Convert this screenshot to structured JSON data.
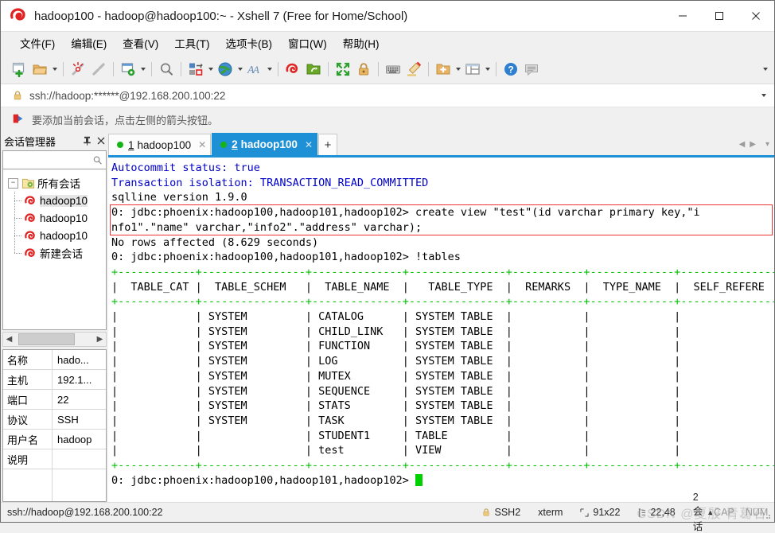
{
  "window": {
    "title": "hadoop100 - hadoop@hadoop100:~ - Xshell 7 (Free for Home/School)",
    "icon": "xshell-logo-icon",
    "minimize": "–",
    "maximize": "☐",
    "close": "✕"
  },
  "menu": {
    "items": [
      {
        "label": "文件(F)",
        "name": "menu-file"
      },
      {
        "label": "编辑(E)",
        "name": "menu-edit"
      },
      {
        "label": "查看(V)",
        "name": "menu-view"
      },
      {
        "label": "工具(T)",
        "name": "menu-tools"
      },
      {
        "label": "选项卡(B)",
        "name": "menu-tab"
      },
      {
        "label": "窗口(W)",
        "name": "menu-window"
      },
      {
        "label": "帮助(H)",
        "name": "menu-help"
      }
    ]
  },
  "toolbar": {
    "icons": [
      "new-session-icon",
      "open-folder-icon",
      "disconnect-icon",
      "reconnect-icon",
      "session-properties-icon",
      "find-icon",
      "transfer-file-icon",
      "globe-icon",
      "font-icon",
      "xshell-icon",
      "xftp-icon",
      "fullscreen-icon",
      "lock-icon",
      "keyboard-icon",
      "highlight-icon",
      "add-folder-icon",
      "layout-icon",
      "help-icon",
      "chat-icon"
    ],
    "overflow": "toolbar-overflow-caret"
  },
  "address": {
    "lock": "lock-icon",
    "value": "ssh://hadoop:******@192.168.200.100:22",
    "dropdown": "address-dropdown-caret"
  },
  "notice": {
    "icon": "arrow-flag-icon",
    "text": "要添加当前会话，点击左侧的箭头按钮。"
  },
  "sidebar": {
    "title": "会话管理器",
    "pin": "📌",
    "close": "✕",
    "search_icon": "search-icon",
    "search_placeholder": "",
    "root": {
      "label": "所有会话",
      "expander": "−"
    },
    "sessions": [
      {
        "label": "hadoop10",
        "selected": true
      },
      {
        "label": "hadoop10",
        "selected": false
      },
      {
        "label": "hadoop10",
        "selected": false
      },
      {
        "label": "新建会话",
        "selected": false
      }
    ],
    "hscroll": {
      "left": "◀",
      "right": "▶"
    },
    "properties": [
      {
        "key": "名称",
        "value": "hado..."
      },
      {
        "key": "主机",
        "value": "192.1..."
      },
      {
        "key": "端口",
        "value": "22"
      },
      {
        "key": "协议",
        "value": "SSH"
      },
      {
        "key": "用户名",
        "value": "hadoop"
      },
      {
        "key": "说明",
        "value": ""
      },
      {
        "key": "",
        "value": ""
      }
    ]
  },
  "tabs": {
    "items": [
      {
        "num": "1",
        "label": "hadoop100",
        "active": false,
        "close": "✕"
      },
      {
        "num": "2",
        "label": "hadoop100",
        "active": true,
        "close": "✕"
      }
    ],
    "new_tab": "+",
    "nav_prev": "◀",
    "nav_next": "▶",
    "nav_menu": "▾"
  },
  "terminal": {
    "lines": [
      {
        "text": "Autocommit status: true",
        "color": "blue"
      },
      {
        "text": "Transaction isolation: TRANSACTION_READ_COMMITTED",
        "color": "blue"
      },
      {
        "text": "sqlline version 1.9.0",
        "color": "black"
      },
      {
        "text": "0: jdbc:phoenix:hadoop100,hadoop101,hadoop102> create view \"test\"(id varchar primary key,\"i",
        "color": "black"
      },
      {
        "text": "nfo1\".\"name\" varchar,\"info2\".\"address\" varchar);",
        "color": "black"
      },
      {
        "text": "No rows affected (8.629 seconds)",
        "color": "black"
      },
      {
        "text": "0: jdbc:phoenix:hadoop100,hadoop101,hadoop102> !tables",
        "color": "black"
      },
      {
        "text": "+------------+----------------+--------------+---------------+-----------+-------------+---------------+",
        "color": "green"
      },
      {
        "text": "|  TABLE_CAT |  TABLE_SCHEM   |  TABLE_NAME  |   TABLE_TYPE  |  REMARKS  |  TYPE_NAME  |  SELF_REFERE  |",
        "color": "black"
      },
      {
        "text": "+------------+----------------+--------------+---------------+-----------+-------------+---------------+",
        "color": "green"
      },
      {
        "text": "|            | SYSTEM         | CATALOG      | SYSTEM TABLE  |           |             |               |",
        "color": "black"
      },
      {
        "text": "|            | SYSTEM         | CHILD_LINK   | SYSTEM TABLE  |           |             |               |",
        "color": "black"
      },
      {
        "text": "|            | SYSTEM         | FUNCTION     | SYSTEM TABLE  |           |             |               |",
        "color": "black"
      },
      {
        "text": "|            | SYSTEM         | LOG          | SYSTEM TABLE  |           |             |               |",
        "color": "black"
      },
      {
        "text": "|            | SYSTEM         | MUTEX        | SYSTEM TABLE  |           |             |               |",
        "color": "black"
      },
      {
        "text": "|            | SYSTEM         | SEQUENCE     | SYSTEM TABLE  |           |             |               |",
        "color": "black"
      },
      {
        "text": "|            | SYSTEM         | STATS        | SYSTEM TABLE  |           |             |               |",
        "color": "black"
      },
      {
        "text": "|            | SYSTEM         | TASK         | SYSTEM TABLE  |           |             |               |",
        "color": "black"
      },
      {
        "text": "|            |                | STUDENT1     | TABLE         |           |             |               |",
        "color": "black"
      },
      {
        "text": "|            |                | test         | VIEW          |           |             |               |",
        "color": "black"
      },
      {
        "text": "+------------+----------------+--------------+---------------+-----------+-------------+---------------+",
        "color": "green"
      }
    ],
    "prompt": "0: jdbc:phoenix:hadoop100,hadoop101,hadoop102> ",
    "highlight": {
      "from_line": 3,
      "to_line": 4
    }
  },
  "statusbar": {
    "connection": "ssh://hadoop@192.168.200.100:22",
    "security_icon": "lock-icon",
    "protocol": "SSH2",
    "term_type": "xterm",
    "size_icon": "size-icon",
    "size": "91x22",
    "cursor_icon": "cursor-icon",
    "cursor": "22,48",
    "sessions": "2 会话",
    "sessions_caret": "▲",
    "caps": "CAP",
    "num": "NUM",
    "watermark": "CSDN @夏殷  青葛石"
  }
}
